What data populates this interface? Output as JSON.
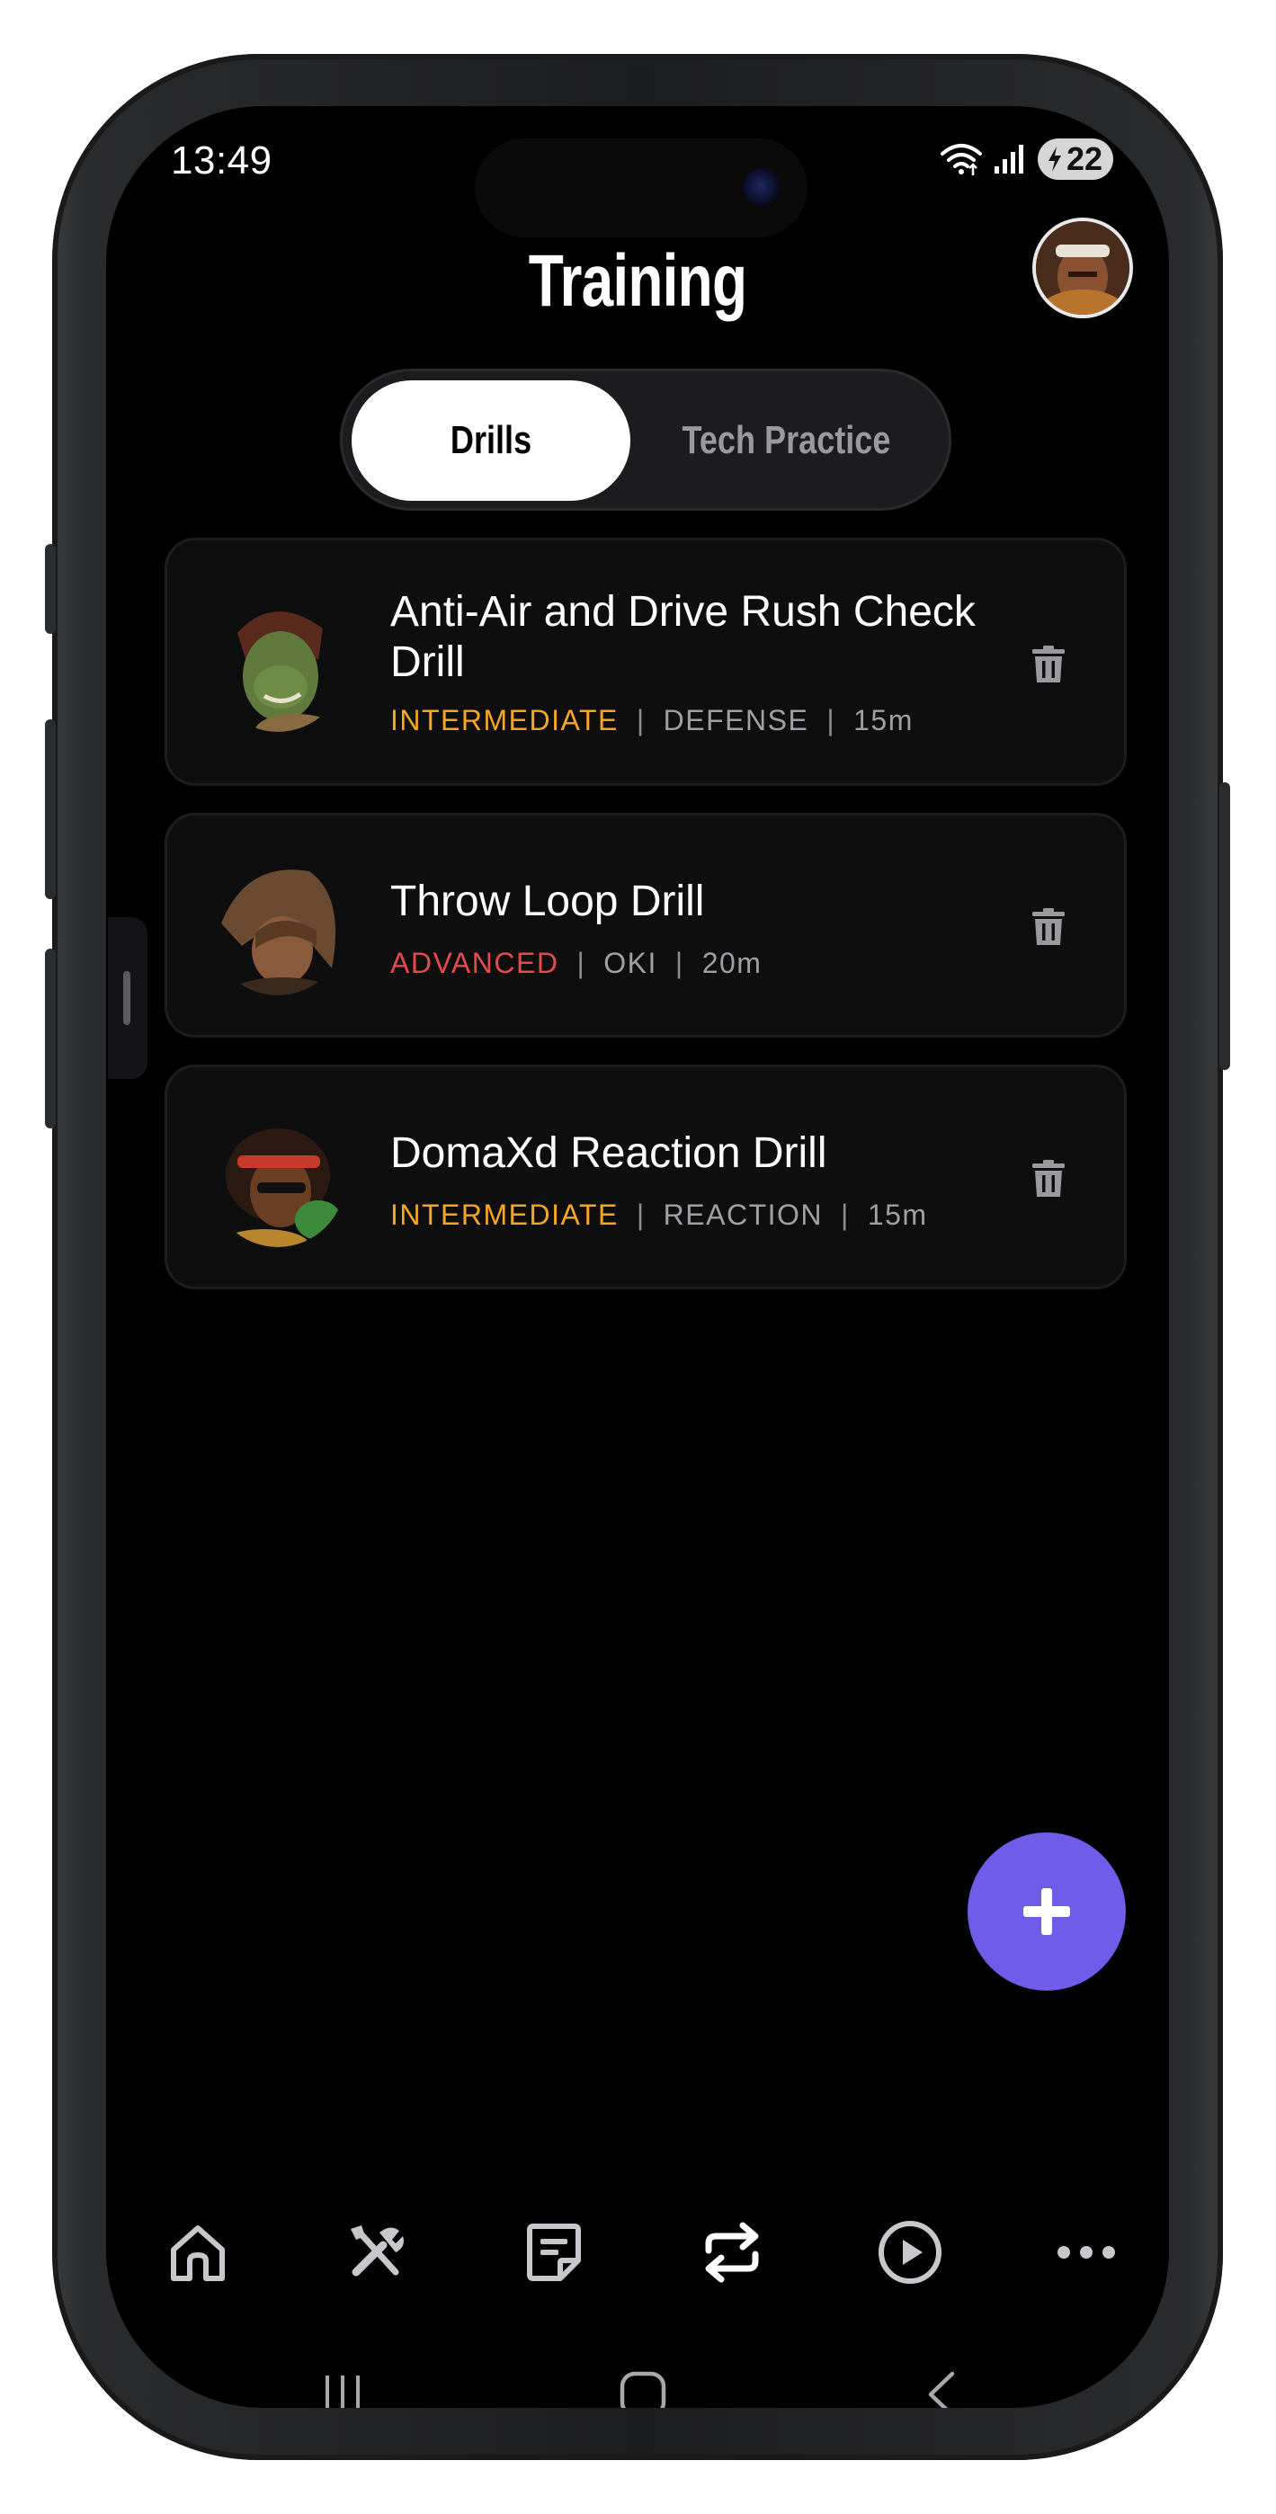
{
  "status_bar": {
    "time": "13:49",
    "battery": "22"
  },
  "header": {
    "title": "Training"
  },
  "tabs": [
    {
      "label": "Drills",
      "active": true
    },
    {
      "label": "Tech Practice",
      "active": false
    }
  ],
  "drills": [
    {
      "title": "Anti-Air and Drive Rush Check Drill",
      "level": "INTERMEDIATE",
      "category": "DEFENSE",
      "duration": "15m"
    },
    {
      "title": "Throw Loop Drill",
      "level": "ADVANCED",
      "category": "OKI",
      "duration": "20m"
    },
    {
      "title": "DomaXd Reaction Drill",
      "level": "INTERMEDIATE",
      "category": "REACTION",
      "duration": "15m"
    }
  ],
  "bottom_nav": [
    "home-icon",
    "tools-icon",
    "notes-icon",
    "repeat-icon",
    "play-icon",
    "more-icon"
  ],
  "colors": {
    "background": "#000000",
    "card": "#0e0e0f",
    "accent": "#6f5ce8",
    "intermediate": "#f5a623",
    "advanced": "#e5484d"
  }
}
